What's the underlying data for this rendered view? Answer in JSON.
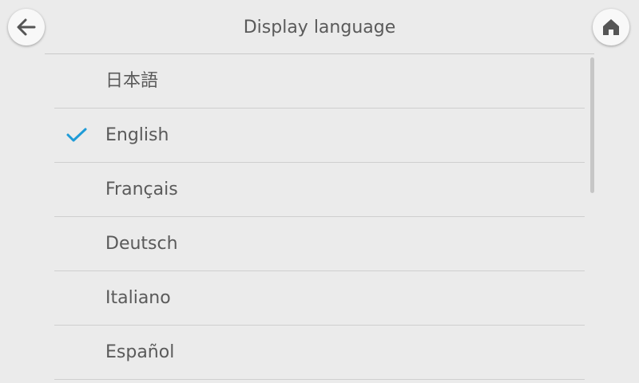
{
  "header": {
    "title": "Display language",
    "back_icon": "arrow-left-icon",
    "home_icon": "home-icon"
  },
  "languages": [
    {
      "label": "日本語",
      "selected": false
    },
    {
      "label": "English",
      "selected": true
    },
    {
      "label": "Français",
      "selected": false
    },
    {
      "label": "Deutsch",
      "selected": false
    },
    {
      "label": "Italiano",
      "selected": false
    },
    {
      "label": "Español",
      "selected": false
    }
  ],
  "colors": {
    "background": "#ebebeb",
    "check_accent": "#1e9bd7",
    "text": "#5a5a5a",
    "divider": "#cfcfcf"
  }
}
